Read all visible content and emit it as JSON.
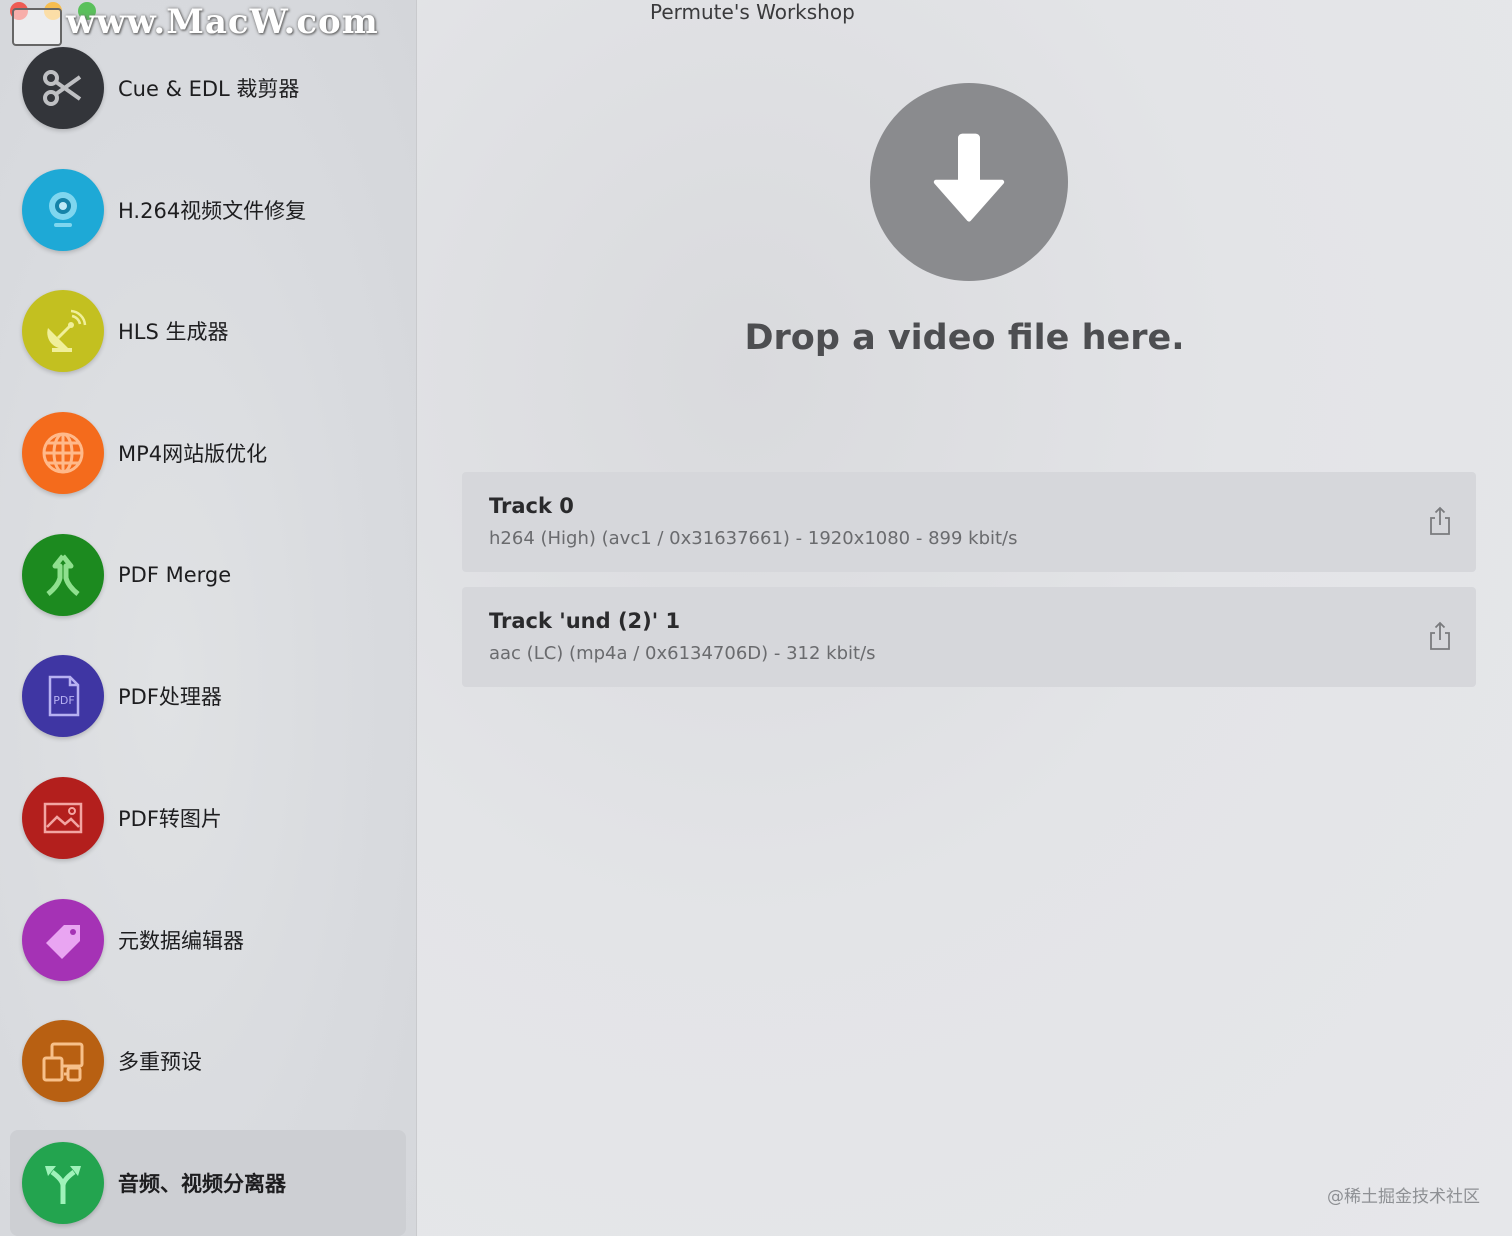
{
  "window": {
    "title": "Permute's Workshop",
    "watermark": "www.MacW.com"
  },
  "sidebar": {
    "items": [
      {
        "label": "Cue & EDL 裁剪器",
        "icon": "scissors-icon",
        "color": "#33353a"
      },
      {
        "label": "H.264视频文件修复",
        "icon": "webcam-icon",
        "color": "#1ea9d6"
      },
      {
        "label": "HLS 生成器",
        "icon": "satellite-dish-icon",
        "color": "#c3c020"
      },
      {
        "label": "MP4网站版优化",
        "icon": "globe-icon",
        "color": "#f46b1c"
      },
      {
        "label": "PDF Merge",
        "icon": "merge-arrow-icon",
        "color": "#1c8a1f"
      },
      {
        "label": "PDF处理器",
        "icon": "pdf-document-icon",
        "color": "#3f36a3"
      },
      {
        "label": "PDF转图片",
        "icon": "image-icon",
        "color": "#b31f1d"
      },
      {
        "label": "元数据编辑器",
        "icon": "tag-icon",
        "color": "#a532b5"
      },
      {
        "label": "多重预设",
        "icon": "devices-icon",
        "color": "#b86012"
      },
      {
        "label": "音频、视频分离器",
        "icon": "split-arrow-icon",
        "color": "#23a44f",
        "selected": true
      }
    ]
  },
  "main": {
    "drop_text": "Drop a video file here.",
    "tracks": [
      {
        "title": "Track 0",
        "detail": "h264 (High) (avc1 / 0x31637661) - 1920x1080 - 899 kbit/s"
      },
      {
        "title": "Track 'und (2)' 1",
        "detail": "aac (LC) (mp4a / 0x6134706D) - 312 kbit/s"
      }
    ]
  },
  "footer": {
    "watermark": "@稀土掘金技术社区"
  }
}
